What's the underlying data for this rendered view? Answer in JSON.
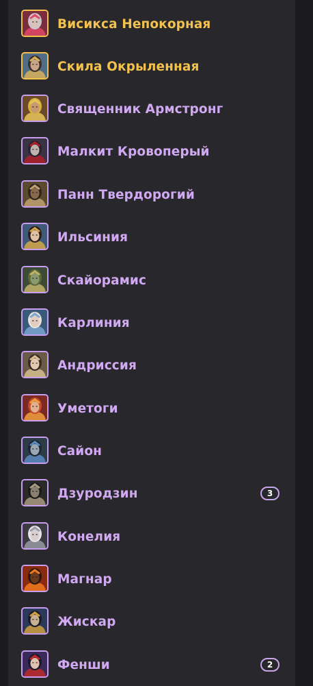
{
  "champions": [
    {
      "name": "Висикса Непокорная",
      "rarity": "legendary",
      "bg": "#7a2d3a",
      "skin": "#d9c2b8",
      "hair": "#c9c4d0",
      "accent": "#e24a6a",
      "badge": null
    },
    {
      "name": "Скила Окрыленная",
      "rarity": "legendary",
      "bg": "#4f6e86",
      "skin": "#c9a58a",
      "hair": "#3b2f2a",
      "accent": "#d8b35a",
      "badge": null
    },
    {
      "name": "Священник Армстронг",
      "rarity": "epic",
      "bg": "#6b4a28",
      "skin": "#c89a72",
      "hair": "#d9b040",
      "accent": "#e7c45a",
      "badge": null
    },
    {
      "name": "Малкит Кровоперый",
      "rarity": "epic",
      "bg": "#3a3346",
      "skin": "#bfb3b0",
      "hair": "#2a232e",
      "accent": "#b0202a",
      "badge": null
    },
    {
      "name": "Панн Твердорогий",
      "rarity": "epic",
      "bg": "#5a4a30",
      "skin": "#8a6a4e",
      "hair": "#2e2418",
      "accent": "#c0a070",
      "badge": null
    },
    {
      "name": "Ильсиния",
      "rarity": "epic",
      "bg": "#3f5a78",
      "skin": "#e0c2a8",
      "hair": "#2c1e18",
      "accent": "#d4a84a",
      "badge": null
    },
    {
      "name": "Скайорамис",
      "rarity": "epic",
      "bg": "#3c4a36",
      "skin": "#8a9a70",
      "hair": "#5a6a3a",
      "accent": "#c4b46a",
      "badge": null
    },
    {
      "name": "Карлиния",
      "rarity": "epic",
      "bg": "#3a5a7a",
      "skin": "#e2ccc0",
      "hair": "#e6e0da",
      "accent": "#7aa6d0",
      "badge": null
    },
    {
      "name": "Андриссия",
      "rarity": "epic",
      "bg": "#6a5a48",
      "skin": "#e4c8b0",
      "hair": "#3a2a22",
      "accent": "#d8c090",
      "badge": null
    },
    {
      "name": "Уметоги",
      "rarity": "epic",
      "bg": "#7a2a22",
      "skin": "#e0b090",
      "hair": "#c04a2a",
      "accent": "#f0a040",
      "badge": null
    },
    {
      "name": "Сайон",
      "rarity": "epic",
      "bg": "#2e3c4a",
      "skin": "#9aa8b4",
      "hair": "#1e2630",
      "accent": "#5a8ac0",
      "badge": null
    },
    {
      "name": "Дзуродзин",
      "rarity": "epic",
      "bg": "#2a2a2a",
      "skin": "#8a8070",
      "hair": "#1a1a1a",
      "accent": "#a89a80",
      "badge": "3"
    },
    {
      "name": "Конелия",
      "rarity": "epic",
      "bg": "#3a3a40",
      "skin": "#d8d0d0",
      "hair": "#e8e4e6",
      "accent": "#9a9aa8",
      "badge": null
    },
    {
      "name": "Магнар",
      "rarity": "epic",
      "bg": "#8a2a10",
      "skin": "#6a3a20",
      "hair": "#2a1a10",
      "accent": "#f07a20",
      "badge": null
    },
    {
      "name": "Жискар",
      "rarity": "epic",
      "bg": "#2a3a58",
      "skin": "#c8b090",
      "hair": "#1a1a2a",
      "accent": "#d0a040",
      "badge": null
    },
    {
      "name": "Фенши",
      "rarity": "epic",
      "bg": "#3a2a5a",
      "skin": "#e0c0b0",
      "hair": "#1a1a2e",
      "accent": "#c02a2a",
      "badge": "2"
    }
  ],
  "colors": {
    "legendary_text": "#f2c14e",
    "legendary_border": "#f2c14e",
    "epic_text": "#d1a8f2",
    "epic_border": "#c89ef0",
    "panel_bg": "#28282c",
    "page_bg": "#1b1b1d"
  }
}
